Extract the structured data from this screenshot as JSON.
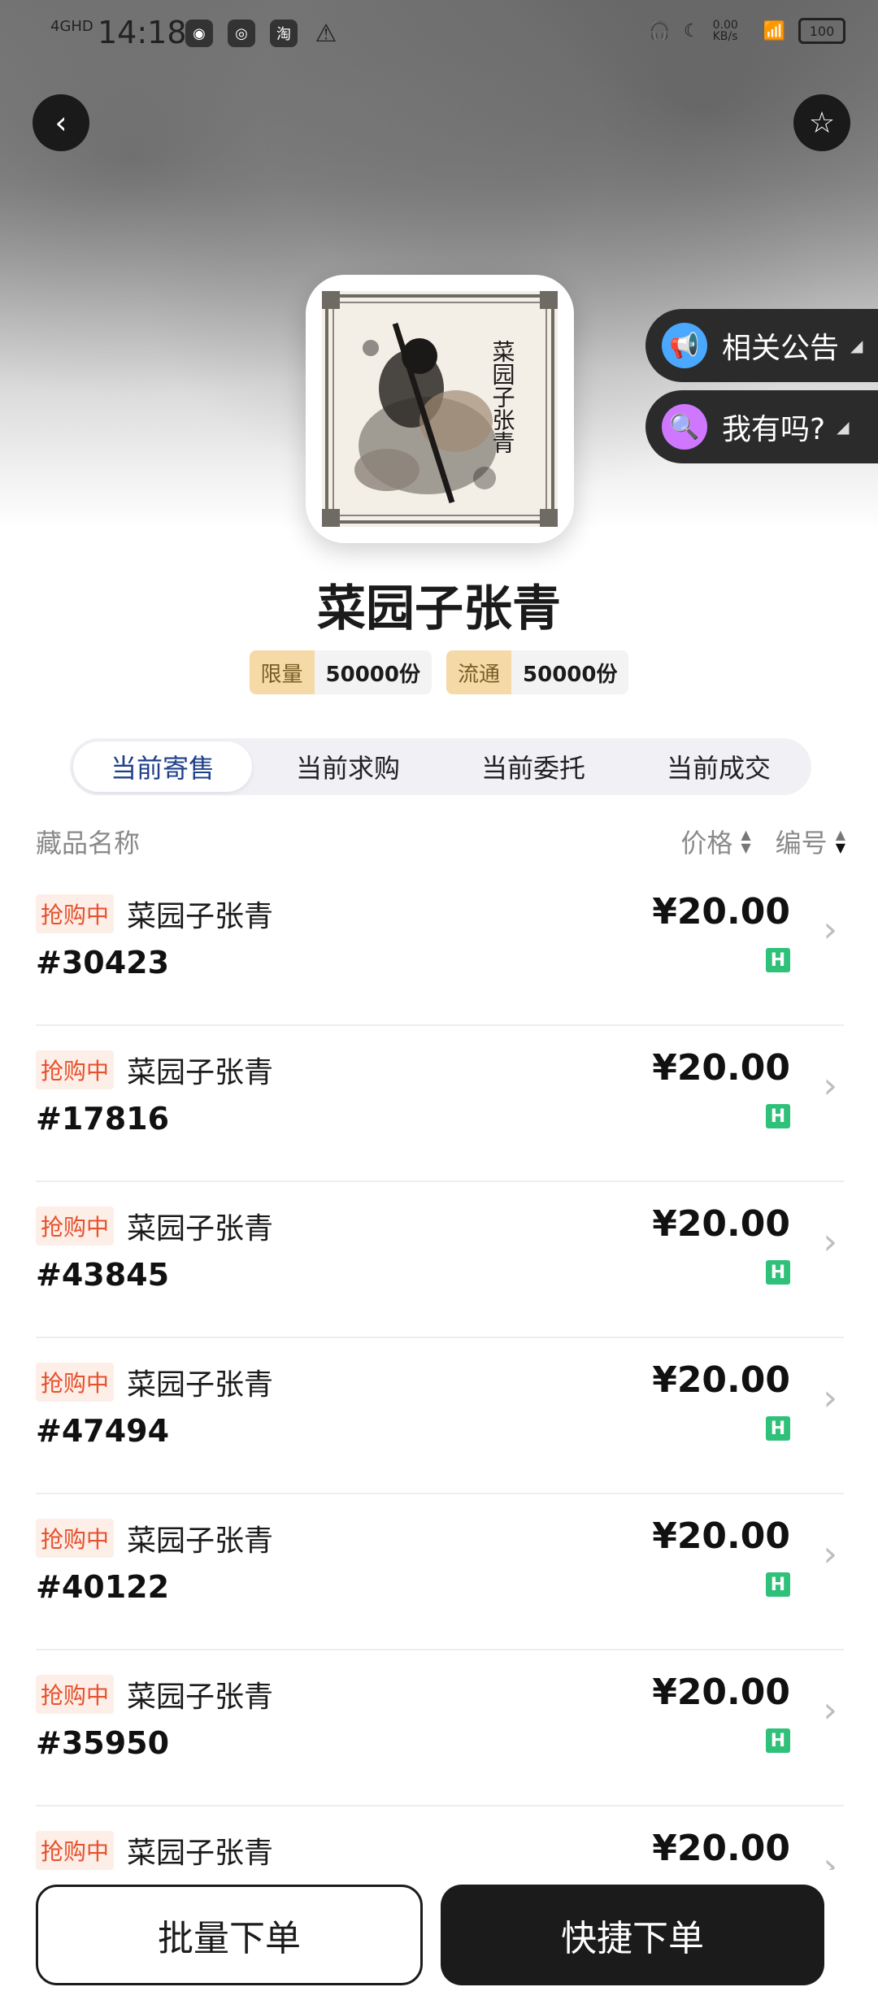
{
  "status_bar": {
    "network": "4GHD",
    "time": "14:18",
    "speed": "0.00 KB/s",
    "battery": "100"
  },
  "header": {
    "back_icon": "chevron-left-icon",
    "favorite_icon": "star-outline-icon"
  },
  "side_pills": {
    "notice_label": "相关公告",
    "mine_label": "我有吗?"
  },
  "collection": {
    "title": "菜园子张青",
    "stats": [
      {
        "label": "限量",
        "value": "50000份"
      },
      {
        "label": "流通",
        "value": "50000份"
      }
    ]
  },
  "tabs": [
    {
      "label": "当前寄售",
      "active": true
    },
    {
      "label": "当前求购",
      "active": false
    },
    {
      "label": "当前委托",
      "active": false
    },
    {
      "label": "当前成交",
      "active": false
    }
  ],
  "list_header": {
    "name_col": "藏品名称",
    "price_col": "价格",
    "serial_col": "编号"
  },
  "items": [
    {
      "tag": "抢购中",
      "name": "菜园子张青",
      "serial": "#30423",
      "price": "¥20.00",
      "chain_badge": "H"
    },
    {
      "tag": "抢购中",
      "name": "菜园子张青",
      "serial": "#17816",
      "price": "¥20.00",
      "chain_badge": "H"
    },
    {
      "tag": "抢购中",
      "name": "菜园子张青",
      "serial": "#43845",
      "price": "¥20.00",
      "chain_badge": "H"
    },
    {
      "tag": "抢购中",
      "name": "菜园子张青",
      "serial": "#47494",
      "price": "¥20.00",
      "chain_badge": "H"
    },
    {
      "tag": "抢购中",
      "name": "菜园子张青",
      "serial": "#40122",
      "price": "¥20.00",
      "chain_badge": "H"
    },
    {
      "tag": "抢购中",
      "name": "菜园子张青",
      "serial": "#35950",
      "price": "¥20.00",
      "chain_badge": "H"
    },
    {
      "tag": "抢购中",
      "name": "菜园子张青",
      "serial": "",
      "price": "¥20.00",
      "chain_badge": ""
    }
  ],
  "bottom_bar": {
    "batch_label": "批量下单",
    "quick_label": "快捷下单"
  },
  "colors": {
    "accent_tab": "#1e3f8a",
    "tag_text": "#e5522e",
    "chain_badge": "#2fc07a",
    "stat_label_bg": "#f5d9a6"
  }
}
